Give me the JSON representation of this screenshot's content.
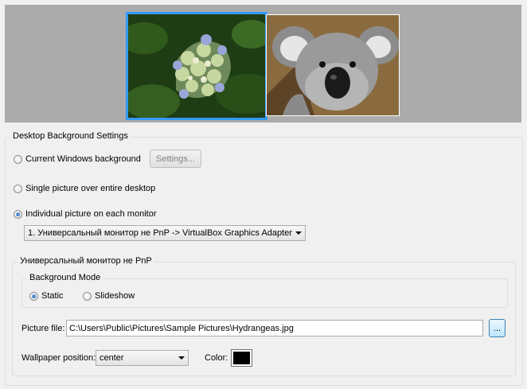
{
  "preview": {
    "monitors": [
      {
        "image": "hydrangea-flowers",
        "selected": true
      },
      {
        "image": "koala",
        "selected": false
      }
    ]
  },
  "settings": {
    "group_title": "Desktop Background Settings",
    "options": {
      "current": "Current Windows background",
      "single": "Single picture over entire desktop",
      "individual": "Individual picture on each monitor"
    },
    "selected_option": "individual",
    "settings_button": "Settings...",
    "monitor_select": "1. Универсальный монитор не PnP -> VirtualBox Graphics Adapter"
  },
  "monitor_group": {
    "title": "Универсальный монитор не PnP",
    "background_mode": {
      "title": "Background Mode",
      "static": "Static",
      "slideshow": "Slideshow",
      "selected": "static"
    },
    "picture_file_label": "Picture file:",
    "picture_file_value": "C:\\Users\\Public\\Pictures\\Sample Pictures\\Hydrangeas.jpg",
    "browse_label": "...",
    "wallpaper_position_label": "Wallpaper position:",
    "wallpaper_position_value": "center",
    "color_label": "Color:",
    "color_value": "#000000"
  },
  "colors": {
    "selection_border": "#3399ff",
    "preview_bg": "#ababab"
  }
}
